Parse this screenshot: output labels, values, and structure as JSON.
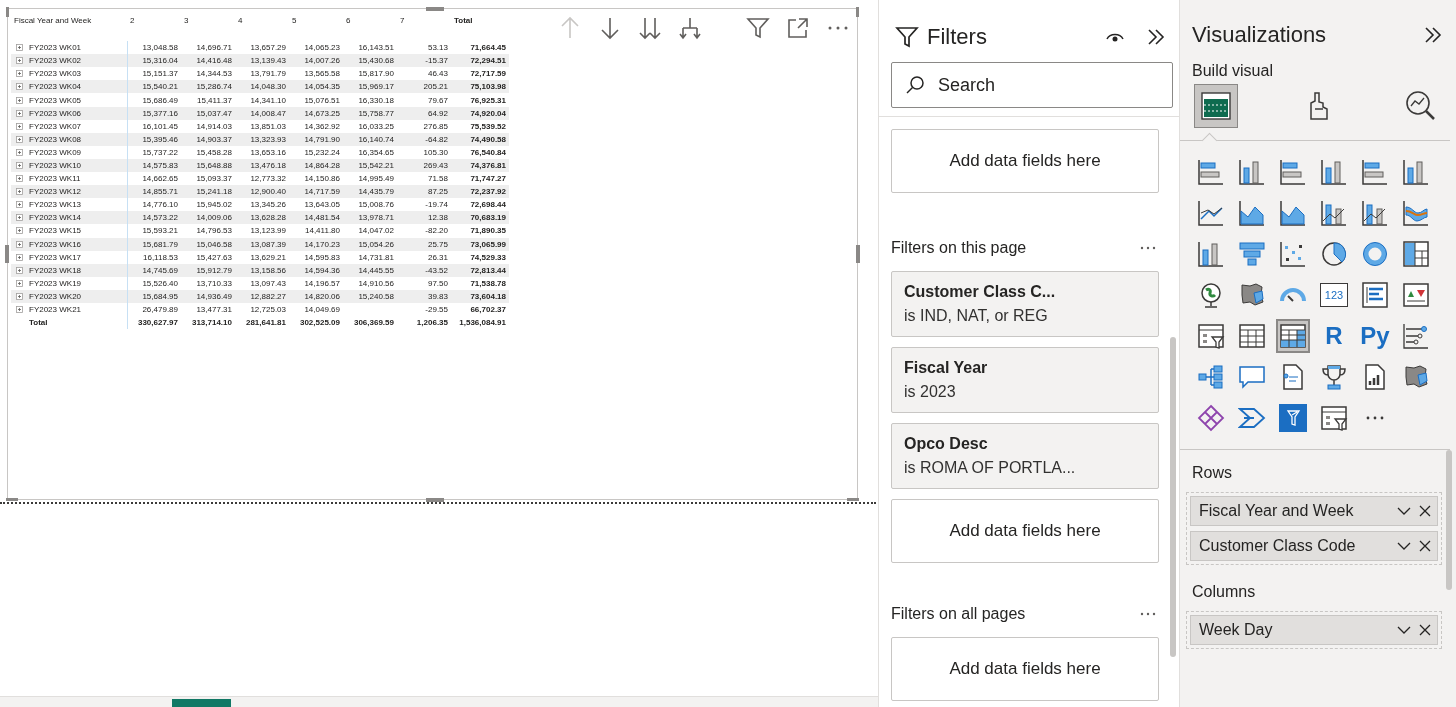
{
  "table": {
    "columns": [
      "Fiscal Year and Week",
      "2",
      "3",
      "4",
      "5",
      "6",
      "7",
      "Total"
    ],
    "rows": [
      {
        "label": "FY2023 WK01",
        "values": [
          "13,048.58",
          "14,696.71",
          "13,657.29",
          "14,065.23",
          "16,143.51",
          "53.13"
        ],
        "total": "71,664.45"
      },
      {
        "label": "FY2023 WK02",
        "values": [
          "15,316.04",
          "14,416.48",
          "13,139.43",
          "14,007.26",
          "15,430.68",
          "-15.37"
        ],
        "total": "72,294.51"
      },
      {
        "label": "FY2023 WK03",
        "values": [
          "15,151.37",
          "14,344.53",
          "13,791.79",
          "13,565.58",
          "15,817.90",
          "46.43"
        ],
        "total": "72,717.59"
      },
      {
        "label": "FY2023 WK04",
        "values": [
          "15,540.21",
          "15,286.74",
          "14,048.30",
          "14,054.35",
          "15,969.17",
          "205.21"
        ],
        "total": "75,103.98"
      },
      {
        "label": "FY2023 WK05",
        "values": [
          "15,686.49",
          "15,411.37",
          "14,341.10",
          "15,076.51",
          "16,330.18",
          "79.67"
        ],
        "total": "76,925.31"
      },
      {
        "label": "FY2023 WK06",
        "values": [
          "15,377.16",
          "15,037.47",
          "14,008.47",
          "14,673.25",
          "15,758.77",
          "64.92"
        ],
        "total": "74,920.04"
      },
      {
        "label": "FY2023 WK07",
        "values": [
          "16,101.45",
          "14,914.03",
          "13,851.03",
          "14,362.92",
          "16,033.25",
          "276.85"
        ],
        "total": "75,539.52"
      },
      {
        "label": "FY2023 WK08",
        "values": [
          "15,395.46",
          "14,903.37",
          "13,323.93",
          "14,791.90",
          "16,140.74",
          "-64.82"
        ],
        "total": "74,490.58"
      },
      {
        "label": "FY2023 WK09",
        "values": [
          "15,737.22",
          "15,458.28",
          "13,653.16",
          "15,232.24",
          "16,354.65",
          "105.30"
        ],
        "total": "76,540.84"
      },
      {
        "label": "FY2023 WK10",
        "values": [
          "14,575.83",
          "15,648.88",
          "13,476.18",
          "14,864.28",
          "15,542.21",
          "269.43"
        ],
        "total": "74,376.81"
      },
      {
        "label": "FY2023 WK11",
        "values": [
          "14,662.65",
          "15,093.37",
          "12,773.32",
          "14,150.86",
          "14,995.49",
          "71.58"
        ],
        "total": "71,747.27"
      },
      {
        "label": "FY2023 WK12",
        "values": [
          "14,855.71",
          "15,241.18",
          "12,900.40",
          "14,717.59",
          "14,435.79",
          "87.25"
        ],
        "total": "72,237.92"
      },
      {
        "label": "FY2023 WK13",
        "values": [
          "14,776.10",
          "15,945.02",
          "13,345.26",
          "13,643.05",
          "15,008.76",
          "-19.74"
        ],
        "total": "72,698.44"
      },
      {
        "label": "FY2023 WK14",
        "values": [
          "14,573.22",
          "14,009.06",
          "13,628.28",
          "14,481.54",
          "13,978.71",
          "12.38"
        ],
        "total": "70,683.19"
      },
      {
        "label": "FY2023 WK15",
        "values": [
          "15,593.21",
          "14,796.53",
          "13,123.99",
          "14,411.80",
          "14,047.02",
          "-82.20"
        ],
        "total": "71,890.35"
      },
      {
        "label": "FY2023 WK16",
        "values": [
          "15,681.79",
          "15,046.58",
          "13,087.39",
          "14,170.23",
          "15,054.26",
          "25.75"
        ],
        "total": "73,065.99"
      },
      {
        "label": "FY2023 WK17",
        "values": [
          "16,118.53",
          "15,427.63",
          "13,629.21",
          "14,595.83",
          "14,731.81",
          "26.31"
        ],
        "total": "74,529.33"
      },
      {
        "label": "FY2023 WK18",
        "values": [
          "14,745.69",
          "15,912.79",
          "13,158.56",
          "14,594.36",
          "14,445.55",
          "-43.52"
        ],
        "total": "72,813.44"
      },
      {
        "label": "FY2023 WK19",
        "values": [
          "15,526.40",
          "13,710.33",
          "13,097.43",
          "14,196.57",
          "14,910.56",
          "97.50"
        ],
        "total": "71,538.78"
      },
      {
        "label": "FY2023 WK20",
        "values": [
          "15,684.95",
          "14,936.49",
          "12,882.27",
          "14,820.06",
          "15,240.58",
          "39.83"
        ],
        "total": "73,604.18"
      },
      {
        "label": "FY2023 WK21",
        "values": [
          "26,479.89",
          "13,477.31",
          "12,725.03",
          "14,049.69",
          "-29.55"
        ],
        "sixth_column_blank": true,
        "total": "66,702.37"
      }
    ],
    "total_row": {
      "label": "Total",
      "values": [
        "330,627.97",
        "313,714.10",
        "281,641.81",
        "302,525.09",
        "306,369.59",
        "1,206.35"
      ],
      "total": "1,536,084.91"
    }
  },
  "filters": {
    "title": "Filters",
    "search": {
      "placeholder": "Search"
    },
    "visual_well": "Add data fields here",
    "page_section": {
      "heading": "Filters on this page",
      "cards": [
        {
          "title": "Customer Class C...",
          "summary": "is IND, NAT, or REG"
        },
        {
          "title": "Fiscal Year",
          "summary": "is 2023"
        },
        {
          "title": "Opco Desc",
          "summary": "is ROMA OF PORTLA..."
        }
      ],
      "well": "Add data fields here"
    },
    "all_section": {
      "heading": "Filters on all pages",
      "well": "Add data fields here"
    }
  },
  "visualizations": {
    "title": "Visualizations",
    "subtitle": "Build visual",
    "modes": [
      {
        "kind": "build",
        "selected": true
      },
      {
        "kind": "format",
        "selected": false
      },
      {
        "kind": "analytics",
        "selected": false
      }
    ],
    "gallery": [
      {
        "kind": "hbar",
        "selected": false
      },
      {
        "kind": "vbar",
        "selected": false
      },
      {
        "kind": "hbar",
        "selected": false
      },
      {
        "kind": "vbar",
        "selected": false
      },
      {
        "kind": "hbar",
        "selected": false
      },
      {
        "kind": "vbar",
        "selected": false
      },
      {
        "kind": "line",
        "selected": false
      },
      {
        "kind": "area",
        "selected": false
      },
      {
        "kind": "area",
        "selected": false
      },
      {
        "kind": "combo",
        "selected": false
      },
      {
        "kind": "combo",
        "selected": false
      },
      {
        "kind": "ribbon",
        "selected": false
      },
      {
        "kind": "vbar",
        "selected": false
      },
      {
        "kind": "funnel",
        "selected": false
      },
      {
        "kind": "scatter",
        "selected": false
      },
      {
        "kind": "pie",
        "selected": false
      },
      {
        "kind": "donut",
        "selected": false
      },
      {
        "kind": "treemap",
        "selected": false
      },
      {
        "kind": "globe",
        "selected": false
      },
      {
        "kind": "map",
        "selected": false
      },
      {
        "kind": "gauge",
        "selected": false
      },
      {
        "kind": "card",
        "selected": false,
        "label": "123"
      },
      {
        "kind": "list",
        "selected": false
      },
      {
        "kind": "kpi",
        "selected": false
      },
      {
        "kind": "slicer",
        "selected": false
      },
      {
        "kind": "table",
        "selected": false
      },
      {
        "kind": "matrix",
        "selected": true
      },
      {
        "kind": "glyph",
        "selected": false,
        "label": "R"
      },
      {
        "kind": "glyph",
        "selected": false,
        "label": "Py"
      },
      {
        "kind": "influencers",
        "selected": false
      },
      {
        "kind": "tree",
        "selected": false
      },
      {
        "kind": "bubble",
        "selected": false
      },
      {
        "kind": "doc",
        "selected": false
      },
      {
        "kind": "trophy",
        "selected": false
      },
      {
        "kind": "report",
        "selected": false
      },
      {
        "kind": "map",
        "selected": false
      },
      {
        "kind": "diamond",
        "selected": false
      },
      {
        "kind": "chevron",
        "selected": false
      },
      {
        "kind": "tile",
        "selected": false
      },
      {
        "kind": "slicer",
        "selected": false
      },
      {
        "kind": "more",
        "selected": false
      }
    ],
    "wells": [
      {
        "heading": "Rows",
        "fields": [
          "Fiscal Year and Week",
          "Customer Class Code"
        ]
      },
      {
        "heading": "Columns",
        "fields": [
          "Week Day"
        ]
      }
    ]
  }
}
